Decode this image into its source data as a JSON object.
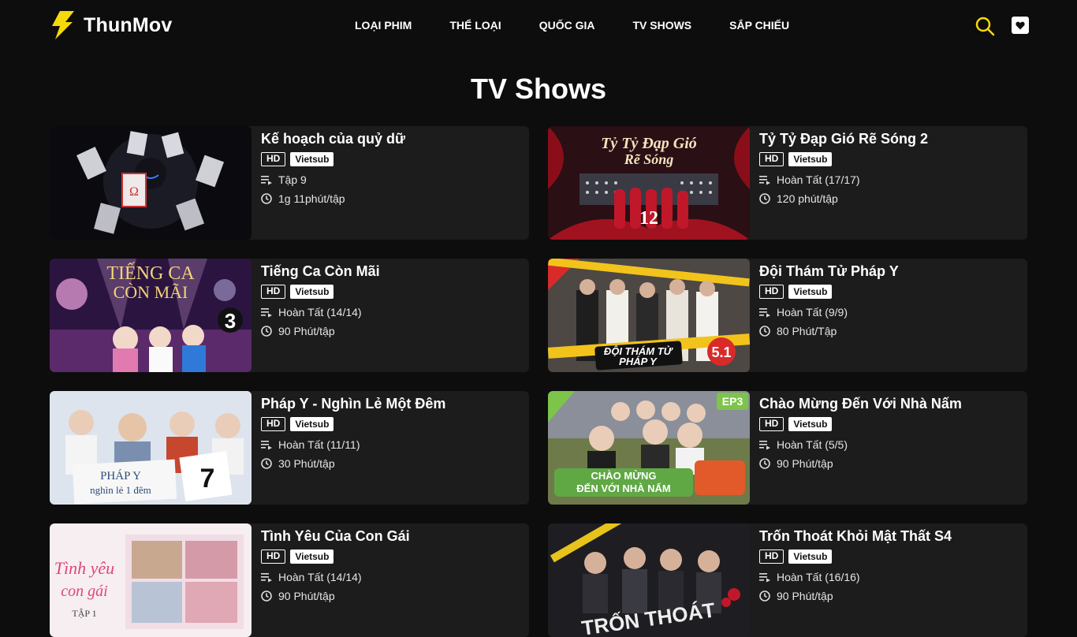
{
  "brand": {
    "name": "ThunMov",
    "accent": "#f5d90a"
  },
  "nav": {
    "items": [
      "Loại phim",
      "Thể loại",
      "Quốc gia",
      "TV Shows",
      "Sắp chiếu"
    ]
  },
  "header": {
    "search_icon": "search-icon",
    "favorite_icon": "heart-icon"
  },
  "page": {
    "title": "TV Shows"
  },
  "shows": [
    {
      "title": "Kế hoạch của quỷ dữ",
      "quality": "HD",
      "lang": "Vietsub",
      "episodes": "Tập 9",
      "duration": "1g 11phút/tập"
    },
    {
      "title": "Tỷ Tỷ Đạp Gió Rẽ Sóng 2",
      "quality": "HD",
      "lang": "Vietsub",
      "episodes": "Hoàn Tất (17/17)",
      "duration": "120 phút/tập"
    },
    {
      "title": "Tiếng Ca Còn Mãi",
      "quality": "HD",
      "lang": "Vietsub",
      "episodes": "Hoàn Tất (14/14)",
      "duration": "90 Phút/tập"
    },
    {
      "title": "Đội Thám Tử Pháp Y",
      "quality": "HD",
      "lang": "Vietsub",
      "episodes": "Hoàn Tất (9/9)",
      "duration": "80 Phút/Tập"
    },
    {
      "title": "Pháp Y - Nghìn Lẻ Một Đêm",
      "quality": "HD",
      "lang": "Vietsub",
      "episodes": "Hoàn Tất (11/11)",
      "duration": "30 Phút/tập"
    },
    {
      "title": "Chào Mừng Đến Với Nhà Nấm",
      "quality": "HD",
      "lang": "Vietsub",
      "episodes": "Hoàn Tất (5/5)",
      "duration": "90 Phút/tập"
    },
    {
      "title": "Tình Yêu Của Con Gái",
      "quality": "HD",
      "lang": "Vietsub",
      "episodes": "Hoàn Tất (14/14)",
      "duration": "90 Phút/tập"
    },
    {
      "title": "Trốn Thoát Khỏi Mật Thất S4",
      "quality": "HD",
      "lang": "Vietsub",
      "episodes": "Hoàn Tất (16/16)",
      "duration": "90 Phút/tập"
    }
  ]
}
